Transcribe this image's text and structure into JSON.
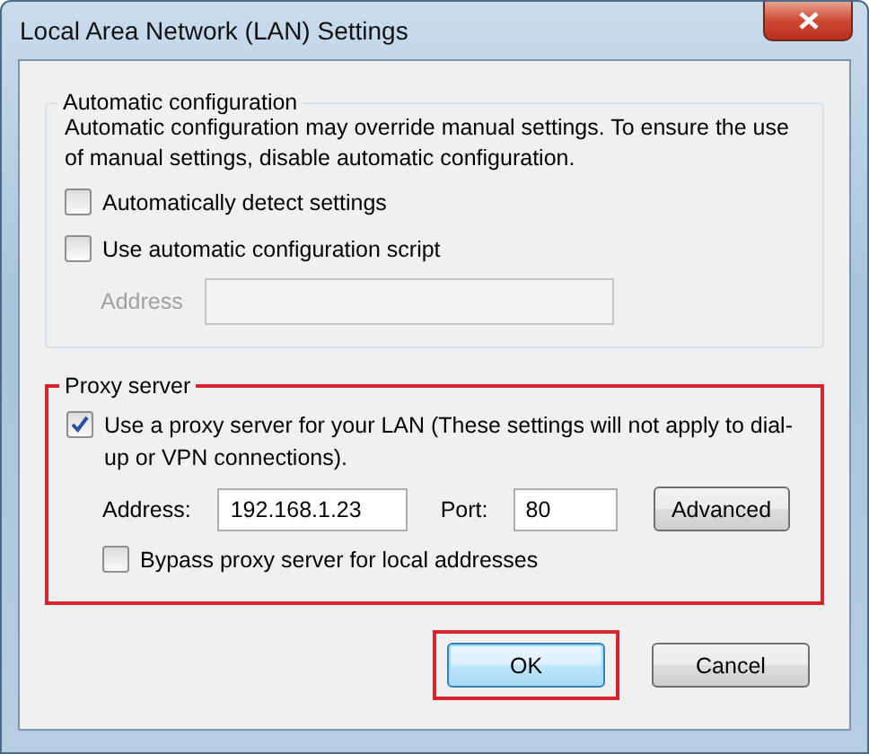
{
  "window": {
    "title": "Local Area Network (LAN) Settings"
  },
  "automatic_configuration": {
    "title": "Automatic configuration",
    "description": "Automatic configuration may override manual settings.  To ensure the use of manual settings, disable automatic configuration.",
    "options": [
      {
        "label": "Automatically detect settings",
        "checked": false
      },
      {
        "label": "Use automatic configuration script",
        "checked": false
      }
    ],
    "address": {
      "label": "Address",
      "disabled": true
    }
  },
  "proxy_server": {
    "title": "Proxy server",
    "highlighted": true,
    "use_proxy": {
      "label": "Use a proxy server for your LAN (These settings will not apply to dial-up or VPN connections).",
      "checked": true
    },
    "address": {
      "label": "Address:",
      "value": "192.168.1.23"
    },
    "port": {
      "label": "Port:",
      "value": "80"
    },
    "advanced_button": "Advanced",
    "bypass": {
      "label": "Bypass proxy server for local addresses",
      "checked": false
    }
  },
  "buttons": [
    {
      "label": "OK",
      "default": true,
      "highlighted": true
    },
    {
      "label": "Cancel",
      "default": false,
      "highlighted": false
    }
  ]
}
